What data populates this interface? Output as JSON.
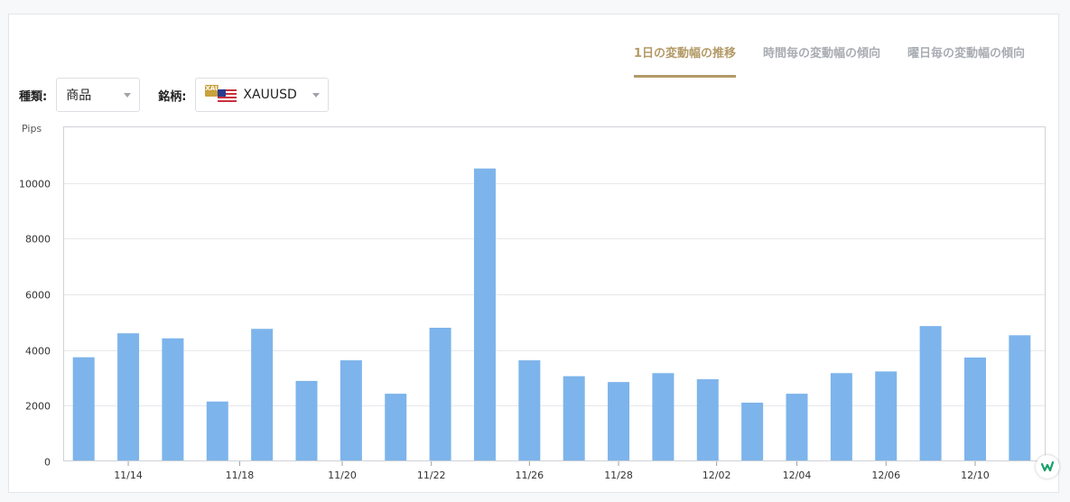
{
  "tabs": [
    {
      "label": "1日の変動幅の推移",
      "active": true
    },
    {
      "label": "時間毎の変動幅の傾向",
      "active": false
    },
    {
      "label": "曜日毎の変動幅の傾向",
      "active": false
    }
  ],
  "filters": {
    "type_label": "種類:",
    "type_value": "商品",
    "symbol_label": "銘柄:",
    "symbol_value": "XAUUSD",
    "symbol_badge": "XAU"
  },
  "colors": {
    "accent": "#b39a67",
    "bar": "#7db4eb"
  },
  "chart_data": {
    "type": "bar",
    "ylabel": "Pips",
    "ylim": [
      0,
      12000
    ],
    "yticks": [
      0,
      2000,
      4000,
      6000,
      8000,
      10000
    ],
    "x_tick_labels": [
      "11/14",
      "11/18",
      "11/20",
      "11/22",
      "11/26",
      "11/28",
      "12/02",
      "12/04",
      "12/06",
      "12/10"
    ],
    "values": [
      3740,
      4600,
      4420,
      2150,
      4760,
      2890,
      3630,
      2430,
      4800,
      10520,
      3630,
      3060,
      2850,
      3170,
      2950,
      2110,
      2430,
      3170,
      3230,
      4860,
      3730,
      4530
    ],
    "grid": true
  }
}
